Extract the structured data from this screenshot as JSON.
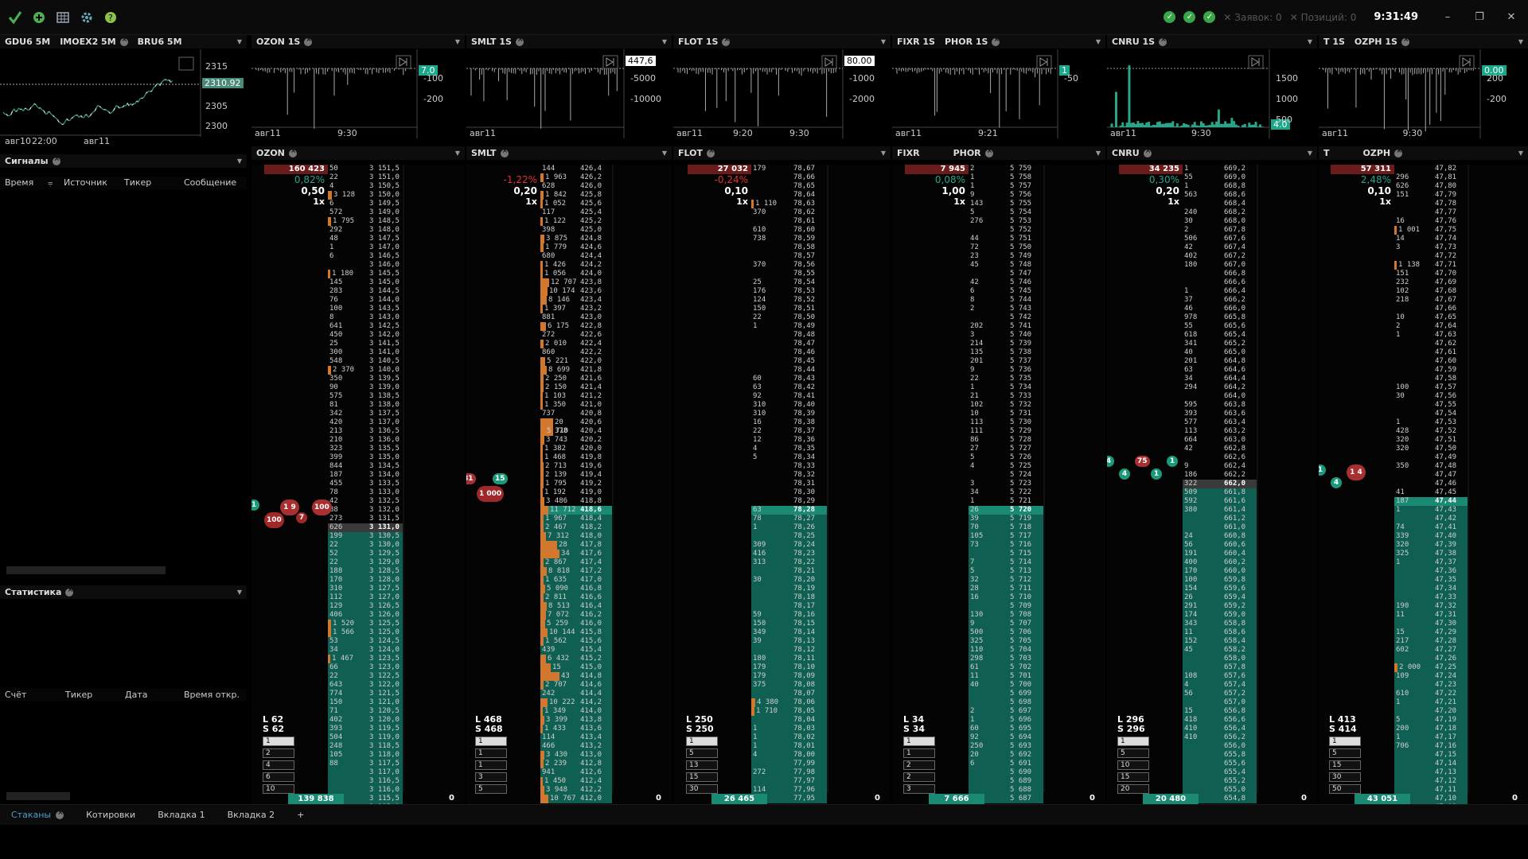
{
  "app": {
    "time": "9:31:49",
    "orders": "Заявок: 0",
    "positions": "Позиций: 0"
  },
  "colors": {
    "bid": "#0f5f52",
    "ask": "#6a1b1b",
    "bid_hi": "#1a8a74",
    "ask_hi": "#a02828",
    "orange": "#d2782e",
    "text": "#cfcfcf"
  },
  "top_icons": [
    "check-logo-icon",
    "add-icon",
    "grid-icon",
    "gear-icon",
    "help-icon"
  ],
  "left_chart": {
    "tabs": [
      "GDU6 5M",
      "IMOEX2 5M",
      "BRU6 5M"
    ],
    "price_ticks": [
      "2315",
      "2310.92",
      "2305",
      "2300"
    ],
    "time_ticks": [
      "авг10",
      "22:00",
      "авг11"
    ]
  },
  "signals": {
    "title": "Сигналы",
    "columns": [
      "Время",
      "Источник",
      "Тикер",
      "Сообщение"
    ]
  },
  "stats": {
    "title": "Статистика",
    "columns": [
      "Счёт",
      "Тикер",
      "Дата",
      "Время откр."
    ]
  },
  "mini_charts": [
    {
      "tabs": [
        "OZON 1S"
      ],
      "tag": "7.0",
      "ticks": [
        "-100",
        "-200"
      ],
      "times": [
        "авг11",
        "9:30"
      ]
    },
    {
      "tabs": [
        "SMLT 1S"
      ],
      "tag": "447,6",
      "ticks": [
        "-5000",
        "-10000"
      ],
      "times": [
        "авг11"
      ]
    },
    {
      "tabs": [
        "FLOT 1S"
      ],
      "tag": "80.00",
      "ticks": [
        "-1000",
        "-2000"
      ],
      "times": [
        "авг11",
        "9:20",
        "9:30"
      ]
    },
    {
      "tabs": [
        "FIXR 1S",
        "PHOR 1S"
      ],
      "tag": "1",
      "ticks": [
        "-50"
      ],
      "times": [
        "авг11",
        "9:21"
      ]
    },
    {
      "tabs": [
        "CNRU 1S"
      ],
      "tag": "4.0",
      "ticks": [
        "1500",
        "1000",
        "500"
      ],
      "times": [
        "авг11",
        "9:30"
      ]
    },
    {
      "tabs": [
        "T 1S",
        "OZPH 1S"
      ],
      "tag": "0.00",
      "ticks": [
        "200",
        "-200"
      ],
      "times": [
        "авг11",
        "9:30"
      ]
    }
  ],
  "orderbooks": [
    {
      "tabs": [
        "OZON"
      ],
      "top_vol": "160 423",
      "pct": "0,82%",
      "step": "0,50",
      "mult": "1x",
      "bottom_vol": "139 838",
      "bottom_right": "0",
      "ls": [
        "L 62",
        "S 62"
      ],
      "levels": [
        "1",
        "2",
        "4",
        "6",
        "10"
      ],
      "bubbles": [
        "1",
        "100",
        "1 9",
        "7",
        "100"
      ],
      "prices": [
        "3 151,5",
        "3 151,0",
        "3 150,5",
        "3 150,0",
        "3 149,5",
        "3 149,0",
        "3 148,5",
        "3 148,0",
        "3 147,5",
        "3 147,0",
        "3 146,5",
        "3 146,0",
        "3 145,5",
        "3 145,0",
        "3 144,5",
        "3 144,0",
        "3 143,5",
        "3 143,0",
        "3 142,5",
        "3 142,0",
        "3 141,5",
        "3 141,0",
        "3 140,5",
        "3 140,0",
        "3 139,5",
        "3 139,0",
        "3 138,5",
        "3 138,0",
        "3 137,5",
        "3 137,0",
        "3 136,5",
        "3 136,0",
        "3 135,5",
        "3 135,0",
        "3 134,5",
        "3 134,0",
        "3 133,5",
        "3 133,0",
        "3 132,5",
        "3 132,0",
        "3 131,5",
        "3 131,0",
        "3 130,5",
        "3 130,0",
        "3 129,5",
        "3 129,0",
        "3 128,5",
        "3 128,0",
        "3 127,5",
        "3 127,0",
        "3 126,5",
        "3 126,0",
        "3 125,5",
        "3 125,0",
        "3 124,5",
        "3 124,0",
        "3 123,5",
        "3 123,0",
        "3 122,5",
        "3 122,0",
        "3 121,5",
        "3 121,0",
        "3 120,5",
        "3 120,0",
        "3 119,5",
        "3 119,0",
        "3 118,5",
        "3 118,0",
        "3 117,5",
        "3 117,0",
        "3 116,5",
        "3 116,0",
        "3 115,5",
        "3 115,0"
      ],
      "vols": [
        "50",
        "22",
        "4",
        "3 128",
        "6",
        "572",
        "1 795",
        "292",
        "48",
        "1",
        "6",
        "",
        "1 180",
        "145",
        "283",
        "76",
        "100",
        "8",
        "641",
        "450",
        "25",
        "300",
        "548",
        "2 370",
        "350",
        "90",
        "575",
        "81",
        "342",
        "420",
        "213",
        "210",
        "323",
        "399",
        "844",
        "187",
        "455",
        "78",
        "42",
        "88",
        "273",
        "626",
        "199",
        "22",
        "52",
        "22",
        "188",
        "170",
        "310",
        "112",
        "129",
        "406",
        "1 520",
        "1 566",
        "53",
        "34",
        "1 467",
        "66",
        "22",
        "643",
        "774",
        "150",
        "71",
        "402",
        "393",
        "504",
        "248",
        "105",
        "88"
      ],
      "vol_start": 0,
      "spread": [
        41,
        42
      ],
      "hl": [
        41
      ],
      "ticks_price": "3 131,0"
    },
    {
      "tabs": [
        "SMLT"
      ],
      "top_vol": "",
      "pct": "-1,22%",
      "step": "0,20",
      "mult": "1x",
      "bottom_vol": "",
      "bottom_right": "0",
      "ls": [
        "L 468",
        "S 468"
      ],
      "levels": [
        "1",
        "1",
        "1",
        "3",
        "5"
      ],
      "bubbles": [
        "81",
        "1 000",
        "15"
      ],
      "prices": [
        "426,4",
        "426,2",
        "426,0",
        "425,8",
        "425,6",
        "425,4",
        "425,2",
        "425,0",
        "424,8",
        "424,6",
        "424,4",
        "424,2",
        "424,0",
        "423,8",
        "423,6",
        "423,4",
        "423,2",
        "423,0",
        "422,8",
        "422,6",
        "422,4",
        "422,2",
        "422,0",
        "421,8",
        "421,6",
        "421,4",
        "421,2",
        "421,0",
        "420,8",
        "420,6",
        "420,4",
        "420,2",
        "420,0",
        "419,8",
        "419,6",
        "419,4",
        "419,2",
        "419,0",
        "418,8",
        "418,6",
        "418,4",
        "418,2",
        "418,0",
        "417,8",
        "417,6",
        "417,4",
        "417,2",
        "417,0",
        "416,8",
        "416,6",
        "416,4",
        "416,2",
        "416,0",
        "415,8",
        "415,6",
        "415,4",
        "415,2",
        "415,0",
        "414,8",
        "414,6",
        "414,4",
        "414,2",
        "414,0",
        "413,8",
        "413,6",
        "413,4",
        "413,2",
        "413,0",
        "412,8",
        "412,6",
        "412,4",
        "412,2",
        "412,0"
      ],
      "vols": [
        "144",
        "1 963",
        "628",
        "1 842",
        "1 052",
        "117",
        "1 122",
        "398",
        "3 875",
        "1 779",
        "680",
        "1 426",
        "1 056",
        "12 707",
        "10 174",
        "8 146",
        "1 397",
        "881",
        "6 175",
        "272",
        "2 010",
        "860",
        "5 221",
        "8 699",
        "2 250",
        "2 150",
        "1 103",
        "1 350",
        "737",
        "20 378",
        "5 710",
        "3 743",
        "1 382",
        "1 468",
        "2 713",
        "2 139",
        "1 795",
        "1 192",
        "3 486",
        "11 712",
        "1 967",
        "2 467",
        "7 312",
        "28 133",
        "34 306",
        "2 867",
        "8 818",
        "1 635",
        "5 090",
        "2 811",
        "8 513",
        "7 072",
        "5 259",
        "10 144",
        "1 562",
        "439",
        "6 432",
        "15 760",
        "43 836",
        "2 707",
        "242",
        "10 222",
        "1 349",
        "3 399",
        "1 433",
        "114",
        "466",
        "3 430",
        "2 239",
        "941",
        "1 450",
        "3 948",
        "10 767"
      ],
      "vol_start": 0,
      "spread": [
        38,
        39
      ],
      "hl": [
        39
      ],
      "ticks_price": "419,0"
    },
    {
      "tabs": [
        "FLOT"
      ],
      "top_vol": "27 032",
      "pct": "-0,24%",
      "step": "0,10",
      "mult": "1x",
      "bottom_vol": "26 465",
      "bottom_right": "0",
      "ls": [
        "L 250",
        "S 250"
      ],
      "levels": [
        "1",
        "5",
        "13",
        "15",
        "30"
      ],
      "bubbles": [],
      "prices": [
        "78,67",
        "78,66",
        "78,65",
        "78,64",
        "78,63",
        "78,62",
        "78,61",
        "78,60",
        "78,59",
        "78,58",
        "78,57",
        "78,56",
        "78,55",
        "78,54",
        "78,53",
        "78,52",
        "78,51",
        "78,50",
        "78,49",
        "78,48",
        "78,47",
        "78,46",
        "78,45",
        "78,44",
        "78,43",
        "78,42",
        "78,41",
        "78,40",
        "78,39",
        "78,38",
        "78,37",
        "78,36",
        "78,35",
        "78,34",
        "78,33",
        "78,32",
        "78,31",
        "78,30",
        "78,29",
        "78,28",
        "78,27",
        "78,26",
        "78,25",
        "78,24",
        "78,23",
        "78,22",
        "78,21",
        "78,20",
        "78,19",
        "78,18",
        "78,17",
        "78,16",
        "78,15",
        "78,14",
        "78,13",
        "78,12",
        "78,11",
        "78,10",
        "78,09",
        "78,08",
        "78,07",
        "78,06",
        "78,05",
        "78,04",
        "78,03",
        "78,02",
        "78,01",
        "78,00",
        "77,99",
        "77,98",
        "77,97",
        "77,96",
        "77,95"
      ],
      "vols": [
        "179",
        "",
        "",
        "",
        "1 110",
        "370",
        "",
        "610",
        "738",
        "",
        "",
        "370",
        "",
        "25",
        "176",
        "124",
        "150",
        "22",
        "1",
        "",
        "",
        "",
        "",
        "",
        "60",
        "63",
        "92",
        "310",
        "310",
        "16",
        "22",
        "12",
        "4",
        "5",
        "",
        "",
        "",
        "",
        "",
        "63",
        "78",
        "1",
        "",
        "309",
        "416",
        "313",
        "",
        "30",
        "",
        "",
        "",
        "59",
        "150",
        "349",
        "39",
        "",
        "180",
        "179",
        "179",
        "375",
        "",
        "4 380",
        "1 710",
        "",
        "1",
        "1",
        "1",
        "4",
        "",
        "272",
        "",
        "114",
        "100"
      ],
      "vol_start": 0,
      "spread": [
        38,
        39
      ],
      "hl": [
        39
      ],
      "ticks_price": "78,50"
    },
    {
      "tabs": [
        "FIXR",
        "PHOR"
      ],
      "top_vol": "7 945",
      "pct": "0,08%",
      "step": "1,00",
      "mult": "1x",
      "bottom_vol": "7 666",
      "bottom_right": "0",
      "ls": [
        "L 34",
        "S 34"
      ],
      "levels": [
        "1",
        "1",
        "2",
        "2",
        "3"
      ],
      "bubbles": [],
      "prices": [
        "5 759",
        "5 758",
        "5 757",
        "5 756",
        "5 755",
        "5 754",
        "5 753",
        "5 752",
        "5 751",
        "5 750",
        "5 749",
        "5 748",
        "5 747",
        "5 746",
        "5 745",
        "5 744",
        "5 743",
        "5 742",
        "5 741",
        "5 740",
        "5 739",
        "5 738",
        "5 737",
        "5 736",
        "5 735",
        "5 734",
        "5 733",
        "5 732",
        "5 731",
        "5 730",
        "5 729",
        "5 728",
        "5 727",
        "5 726",
        "5 725",
        "5 724",
        "5 723",
        "5 722",
        "5 721",
        "5 720",
        "5 719",
        "5 718",
        "5 717",
        "5 716",
        "5 715",
        "5 714",
        "5 713",
        "5 712",
        "5 711",
        "5 710",
        "5 709",
        "5 708",
        "5 707",
        "5 706",
        "5 705",
        "5 704",
        "5 703",
        "5 702",
        "5 701",
        "5 700",
        "5 699",
        "5 698",
        "5 697",
        "5 696",
        "5 695",
        "5 694",
        "5 693",
        "5 692",
        "5 691",
        "5 690",
        "5 689",
        "5 688",
        "5 687"
      ],
      "vols": [
        "2",
        "1",
        "1",
        "9",
        "143",
        "5",
        "276",
        "",
        "44",
        "72",
        "23",
        "45",
        "",
        "42",
        "6",
        "8",
        "2",
        "",
        "202",
        "3",
        "214",
        "135",
        "201",
        "9",
        "22",
        "1",
        "21",
        "102",
        "10",
        "113",
        "111",
        "86",
        "27",
        "5",
        "4",
        "",
        "3",
        "34",
        "1",
        "26",
        "39",
        "70",
        "105",
        "73",
        "",
        "7",
        "5",
        "32",
        "28",
        "16",
        "",
        "130",
        "9",
        "500",
        "325",
        "110",
        "298",
        "61",
        "11",
        "40",
        "",
        "",
        "2",
        "1",
        "60",
        "92",
        "250",
        "20",
        "6"
      ],
      "vol_start": 0,
      "spread": [
        38,
        39
      ],
      "hl": [
        39
      ],
      "ticks_price": "5 720"
    },
    {
      "tabs": [
        "CNRU"
      ],
      "top_vol": "34 235",
      "pct": "0,30%",
      "step": "0,20",
      "mult": "1x",
      "bottom_vol": "20 480",
      "bottom_right": "0",
      "ls": [
        "L 296",
        "S 296"
      ],
      "levels": [
        "1",
        "5",
        "10",
        "15",
        "20"
      ],
      "bubbles": [
        "4",
        "4",
        "75",
        "1",
        "1"
      ],
      "prices": [
        "669,2",
        "669,0",
        "668,8",
        "668,6",
        "668,4",
        "668,2",
        "668,0",
        "667,8",
        "667,6",
        "667,4",
        "667,2",
        "667,0",
        "666,8",
        "666,6",
        "666,4",
        "666,2",
        "666,0",
        "665,8",
        "665,6",
        "665,4",
        "665,2",
        "665,0",
        "664,8",
        "664,6",
        "664,4",
        "664,2",
        "664,0",
        "663,8",
        "663,6",
        "663,4",
        "663,2",
        "663,0",
        "662,8",
        "662,6",
        "662,4",
        "662,2",
        "662,0",
        "661,8",
        "661,6",
        "661,4",
        "661,2",
        "661,0",
        "660,8",
        "660,6",
        "660,4",
        "660,2",
        "660,0",
        "659,8",
        "659,6",
        "659,4",
        "659,2",
        "659,0",
        "658,8",
        "658,6",
        "658,4",
        "658,2",
        "658,0",
        "657,8",
        "657,6",
        "657,4",
        "657,2",
        "657,0",
        "656,8",
        "656,6",
        "656,4",
        "656,2",
        "656,0",
        "655,8",
        "655,6",
        "655,4",
        "655,2",
        "655,0",
        "654,8"
      ],
      "vols": [
        "1",
        "55",
        "1",
        "563",
        "",
        "240",
        "30",
        "2",
        "506",
        "42",
        "402",
        "180",
        "",
        "",
        "1",
        "37",
        "46",
        "978",
        "55",
        "618",
        "341",
        "40",
        "201",
        "63",
        "34",
        "294",
        "",
        "595",
        "393",
        "577",
        "113",
        "664",
        "42",
        "",
        "9",
        "186",
        "322",
        "509",
        "592",
        "380",
        "",
        "",
        "24",
        "56",
        "191",
        "400",
        "170",
        "100",
        "154",
        "26",
        "291",
        "174",
        "343",
        "11",
        "152",
        "45",
        "",
        "",
        "108",
        "4",
        "56",
        "",
        "15",
        "418",
        "410",
        "410"
      ],
      "vol_start": 0,
      "spread": [
        36,
        37
      ],
      "hl": [
        36
      ],
      "ticks_price": "662,4"
    },
    {
      "tabs": [
        "T",
        "OZPH"
      ],
      "top_vol": "57 311",
      "pct": "2,48%",
      "step": "0,10",
      "mult": "1x",
      "bottom_vol": "43 051",
      "bottom_right": "0",
      "ls": [
        "L 413",
        "S 414"
      ],
      "levels": [
        "1",
        "5",
        "15",
        "30",
        "50"
      ],
      "bubbles": [
        "1",
        "4",
        "1 4"
      ],
      "prices": [
        "47,82",
        "47,81",
        "47,80",
        "47,79",
        "47,78",
        "47,77",
        "47,76",
        "47,75",
        "47,74",
        "47,73",
        "47,72",
        "47,71",
        "47,70",
        "47,69",
        "47,68",
        "47,67",
        "47,66",
        "47,65",
        "47,64",
        "47,63",
        "47,62",
        "47,61",
        "47,60",
        "47,59",
        "47,58",
        "47,57",
        "47,56",
        "47,55",
        "47,54",
        "47,53",
        "47,52",
        "47,51",
        "47,50",
        "47,49",
        "47,48",
        "47,47",
        "47,46",
        "47,45",
        "47,44",
        "47,43",
        "47,42",
        "47,41",
        "47,40",
        "47,39",
        "47,38",
        "47,37",
        "47,36",
        "47,35",
        "47,34",
        "47,33",
        "47,32",
        "47,31",
        "47,30",
        "47,29",
        "47,28",
        "47,27",
        "47,26",
        "47,25",
        "47,24",
        "47,23",
        "47,22",
        "47,21",
        "47,20",
        "47,19",
        "47,18",
        "47,17",
        "47,16",
        "47,15",
        "47,14",
        "47,13",
        "47,12",
        "47,11",
        "47,10",
        "47,09"
      ],
      "vols": [
        "",
        "296",
        "626",
        "151",
        "",
        "",
        "16",
        "1 001",
        "14",
        "3",
        "",
        "1 138",
        "151",
        "232",
        "102",
        "218",
        "",
        "10",
        "2",
        "1",
        "",
        "",
        "",
        "",
        "",
        "100",
        "30",
        "",
        "",
        "1",
        "428",
        "320",
        "320",
        "",
        "350",
        "",
        "",
        "41",
        "187",
        "1",
        "",
        "74",
        "339",
        "320",
        "325",
        "1",
        "",
        "",
        "",
        "",
        "190",
        "11",
        "",
        "15",
        "217",
        "602",
        "",
        "2 000",
        "109",
        "",
        "610",
        "1",
        "",
        "5",
        "200",
        "1",
        "706"
      ],
      "vol_start": 0,
      "spread": [
        37,
        38
      ],
      "hl": [
        38
      ],
      "ticks_price": "47,44"
    }
  ],
  "bottom_tabs": [
    "Стаканы",
    "Котировки",
    "Вкладка 1",
    "Вкладка 2",
    "+"
  ]
}
